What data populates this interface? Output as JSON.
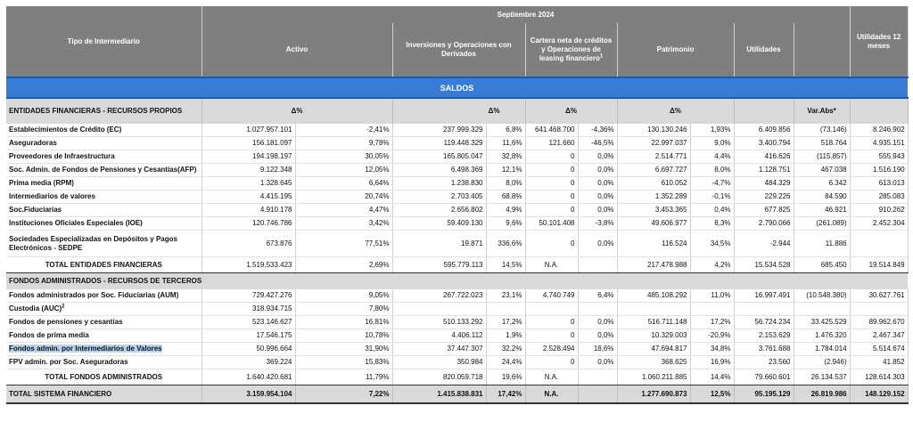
{
  "header": {
    "tipo": "Tipo de Intermediario",
    "period": "Septiembre  2024",
    "activo": "Activo",
    "inversiones": "Inversiones y Operaciones con Derivados",
    "cartera": "Cartera neta de créditos y Operaciones de leasing financiero",
    "cartera_sup": "1",
    "patrimonio": "Patrimonio",
    "utilidades": "Utilidades",
    "utilidades12": "Utilidades 12 meses"
  },
  "band_label": "SALDOS",
  "section1": {
    "title": "ENTIDADES FINANCIERAS - RECURSOS PROPIOS",
    "delta": "Δ%",
    "varabs": "Var.Abs*"
  },
  "rows1": [
    {
      "name": "Establecimientos de Crédito (EC)",
      "activo": "1.027.957.101",
      "d1": "-2,41%",
      "inv": "237.999.329",
      "d2": "6,8%",
      "cart": "641.468.700",
      "d3": "-4,36%",
      "pat": "130.130.246",
      "d4": "1,93%",
      "util": "6.409.856",
      "var": "(73.146)",
      "u12": "8.246.902"
    },
    {
      "name": "Aseguradoras",
      "activo": "156.181.097",
      "d1": "9,78%",
      "inv": "119.448.329",
      "d2": "11,6%",
      "cart": "121.660",
      "d3": "-46,5%",
      "pat": "22.997.037",
      "d4": "9,0%",
      "util": "3.400.794",
      "var": "518.764",
      "u12": "4.935.151"
    },
    {
      "name": "Proveedores de Infraestructura",
      "activo": "194.198.197",
      "d1": "30,05%",
      "inv": "165.805.047",
      "d2": "32,8%",
      "cart": "0",
      "d3": "0,0%",
      "pat": "2.514.771",
      "d4": "4,4%",
      "util": "416.626",
      "var": "(115.857)",
      "u12": "555.943"
    },
    {
      "name": "Soc. Admin. de Fondos de Pensiones y Cesantías(AFP)",
      "activo": "9.122.348",
      "d1": "12,05%",
      "inv": "6.498.369",
      "d2": "12,1%",
      "cart": "0",
      "d3": "0,0%",
      "pat": "6.697.727",
      "d4": "8,0%",
      "util": "1.128.751",
      "var": "467.038",
      "u12": "1.516.190"
    },
    {
      "name": "Prima media (RPM)",
      "activo": "1.328.645",
      "d1": "6,64%",
      "inv": "1.238.830",
      "d2": "8,0%",
      "cart": "0",
      "d3": "0,0%",
      "pat": "610.052",
      "d4": "-4,7%",
      "util": "484.329",
      "var": "6.342",
      "u12": "613.013"
    },
    {
      "name": "Intermediarios de valores",
      "activo": "4.415.195",
      "d1": "20,74%",
      "inv": "2.703.405",
      "d2": "68,8%",
      "cart": "0",
      "d3": "0,0%",
      "pat": "1.352.289",
      "d4": "-0,1%",
      "util": "229.226",
      "var": "84.590",
      "u12": "285.083"
    },
    {
      "name": "Soc.Fiduciarias",
      "activo": "4.910.178",
      "d1": "4,47%",
      "inv": "2.656.802",
      "d2": "4,9%",
      "cart": "0",
      "d3": "0,0%",
      "pat": "3.453.365",
      "d4": "0,4%",
      "util": "677.825",
      "var": "46.921",
      "u12": "910.262"
    },
    {
      "name": "Instituciones Oficiales Especiales (IOE)",
      "activo": "120.746.786",
      "d1": "3,42%",
      "inv": "59.409.130",
      "d2": "9,6%",
      "cart": "50.101.408",
      "d3": "-3,8%",
      "pat": "49.606.977",
      "d4": "8,3%",
      "util": "2.790.066",
      "var": "(261.089)",
      "u12": "2.452.304"
    },
    {
      "name": "Sociedades Especializadas en Depósitos y Pagos Electrónicos - SEDPE",
      "activo": "673.876",
      "d1": "77,51%",
      "inv": "19.871",
      "d2": "336,6%",
      "cart": "0",
      "d3": "0,0%",
      "pat": "116.524",
      "d4": "34,5%",
      "util": "-2.944",
      "var": "11.886",
      "u12": ""
    }
  ],
  "total1": {
    "name": "TOTAL ENTIDADES FINANCIERAS",
    "activo": "1.519.533.423",
    "d1": "2,69%",
    "inv": "595.779.113",
    "d2": "14,5%",
    "cart": "N.A.",
    "d3": "",
    "pat": "217.478.988",
    "d4": "4,2%",
    "util": "15.534.528",
    "var": "685.450",
    "u12": "19.514.849"
  },
  "section2": {
    "title": "FONDOS ADMINISTRADOS - RECURSOS DE TERCEROS"
  },
  "rows2": [
    {
      "name": "Fondos administrados por Soc. Fiduciarias (AUM)",
      "sup": "",
      "activo": "729.427.276",
      "d1": "9,05%",
      "inv": "267.722.023",
      "d2": "23,1%",
      "cart": "4.740.749",
      "d3": "6,4%",
      "pat": "485.108.292",
      "d4": "11,0%",
      "util": "16.997.491",
      "var": "(10.548.380)",
      "u12": "30.627.761"
    },
    {
      "name": "Custodia (AUC)",
      "sup": "2",
      "activo": "318.934.715",
      "d1": "7,80%",
      "inv": "",
      "d2": "",
      "cart": "",
      "d3": "",
      "pat": "",
      "d4": "",
      "util": "",
      "var": "",
      "u12": ""
    },
    {
      "name": "Fondos de pensiones y cesantías",
      "sup": "",
      "activo": "523.146.627",
      "d1": "16,81%",
      "inv": "510.133.292",
      "d2": "17,2%",
      "cart": "0",
      "d3": "0,0%",
      "pat": "516.711.148",
      "d4": "17,2%",
      "util": "56.724.234",
      "var": "33.425.529",
      "u12": "89.962.670"
    },
    {
      "name": "Fondos de prima media",
      "sup": "",
      "activo": "17.546.175",
      "d1": "10,78%",
      "inv": "4.406.112",
      "d2": "1,9%",
      "cart": "0",
      "d3": "0,0%",
      "pat": "10.329.003",
      "d4": "-20,9%",
      "util": "2.153.629",
      "var": "1.476.320",
      "u12": "2.467.347"
    },
    {
      "name": "Fondos admin. por Intermediarios de Valores",
      "sup": "",
      "activo": "50.996.664",
      "d1": "31,90%",
      "inv": "37.447.307",
      "d2": "32,2%",
      "cart": "2.528.494",
      "d3": "18,6%",
      "pat": "47.694.817",
      "d4": "34,8%",
      "util": "3.761.688",
      "var": "1.784.014",
      "u12": "5.514.674"
    },
    {
      "name": "FPV admin. por Soc. Aseguradoras",
      "sup": "",
      "activo": "369.224",
      "d1": "15,83%",
      "inv": "350.984",
      "d2": "24,4%",
      "cart": "0",
      "d3": "0,0%",
      "pat": "368.625",
      "d4": "16,9%",
      "util": "23.560",
      "var": "(2.946)",
      "u12": "41.852"
    }
  ],
  "total2": {
    "name": "TOTAL FONDOS ADMINISTRADOS",
    "activo": "1.640.420.681",
    "d1": "11,79%",
    "inv": "820.059.718",
    "d2": "19,6%",
    "cart": "N.A.",
    "d3": "",
    "pat": "1.060.211.885",
    "d4": "14,4%",
    "util": "79.660.601",
    "var": "26.134.537",
    "u12": "128.614.303"
  },
  "grand": {
    "name": "TOTAL SISTEMA FINANCIERO",
    "activo": "3.159.954.104",
    "d1": "7,22%",
    "inv": "1.415.838.831",
    "d2": "17,42%",
    "cart": "N.A.",
    "d3": "",
    "pat": "1.277.690.873",
    "d4": "12,5%",
    "util": "95.195.129",
    "var": "26.819.986",
    "u12": "148.129.152"
  }
}
